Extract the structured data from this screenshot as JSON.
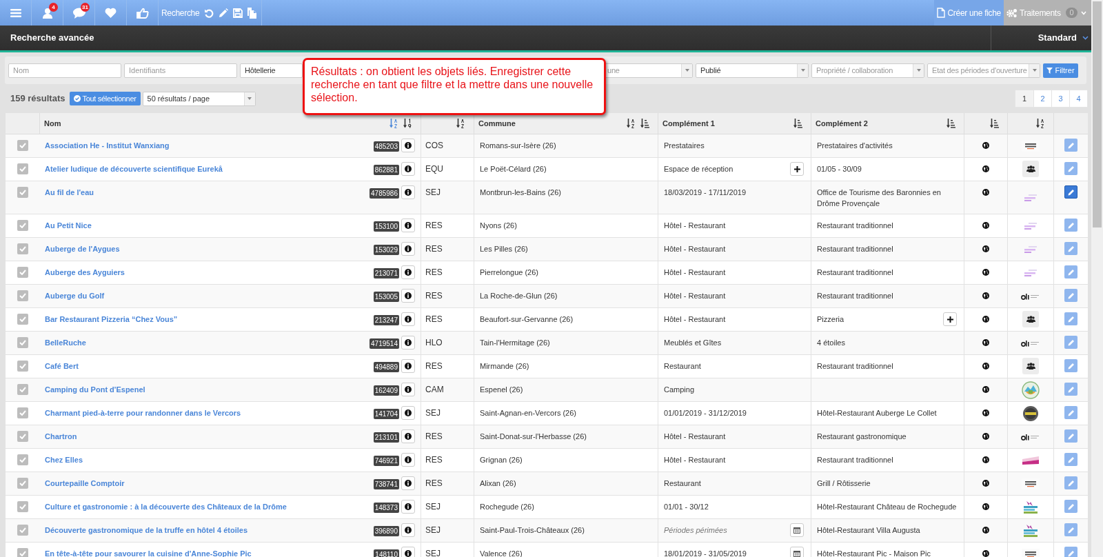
{
  "toolbar": {
    "items": [
      {
        "kind": "menu"
      },
      {
        "kind": "user",
        "badge": "4"
      },
      {
        "kind": "chat",
        "badge": "31"
      },
      {
        "kind": "heart"
      },
      {
        "kind": "thumb"
      }
    ],
    "search_label": "Recherche",
    "search_actions": [
      {
        "kind": "undo"
      },
      {
        "kind": "pencil"
      },
      {
        "kind": "save"
      },
      {
        "kind": "copy"
      }
    ],
    "create_button": "Créer une fiche",
    "treatments": {
      "label": "Traitements",
      "count": "0"
    }
  },
  "header": {
    "title": "Recherche avancée",
    "view": "Standard"
  },
  "filters": [
    {
      "kind": "text",
      "placeholder": "Nom"
    },
    {
      "kind": "text",
      "placeholder": "Identifiants"
    },
    {
      "kind": "select",
      "value": "Hôtellerie"
    },
    {
      "kind": "select",
      "placeholder": "une"
    },
    {
      "kind": "select",
      "value": "Publié"
    },
    {
      "kind": "select",
      "placeholder": "Propriété / collaboration"
    },
    {
      "kind": "select",
      "placeholder": "Etat des périodes d'ouverture"
    }
  ],
  "filter_button": "Filtrer",
  "callout": "Résultats : on obtient les objets liés. Enregistrer cette recherche en tant que filtre et la mettre dans une nouvelle sélection.",
  "results": {
    "count": "159 résultats",
    "select_all": "Tout sélectionner",
    "page_size": "50 résultats / page",
    "pages": [
      {
        "label": "1",
        "selected": true
      },
      {
        "label": "2",
        "selected": false
      },
      {
        "label": "3",
        "selected": false
      },
      {
        "label": "4",
        "selected": false
      }
    ]
  },
  "table": {
    "columns": [
      {},
      {
        "label": "Nom",
        "sort_icons": [
          {
            "kind": "az",
            "selected": true
          },
          {
            "kind": "numeric",
            "selected": false
          }
        ]
      },
      {
        "sort_icons": [
          {
            "kind": "az",
            "selected": false
          }
        ]
      },
      {
        "label": "Commune",
        "sort_icons": [
          {
            "kind": "az",
            "selected": false
          },
          {
            "kind": "bars",
            "selected": false
          }
        ]
      },
      {
        "label": "Complément 1",
        "sort_icons": [
          {
            "kind": "bars",
            "selected": false
          }
        ]
      },
      {
        "label": "Complément 2",
        "sort_icons": [
          {
            "kind": "bars",
            "selected": false
          }
        ]
      },
      {
        "sort_icons": [
          {
            "kind": "bars",
            "selected": false
          }
        ]
      },
      {
        "sort_icons": [
          {
            "kind": "az",
            "selected": false
          }
        ]
      },
      {}
    ],
    "rows": [
      {
        "checked": true,
        "name": "Association He - Institut Wanxiang",
        "id": "485203",
        "type": "COS",
        "commune": "Romans-sur-Isère (26)",
        "complement_1": {
          "text": "Prestataires",
          "italic": false
        },
        "complement_2": {
          "text": "Prestataires d'activités"
        },
        "logo": {
          "kind": "valence"
        },
        "edit_active": false
      },
      {
        "checked": true,
        "name": "Atelier ludique de découverte scientifique Eurekå",
        "id": "862881",
        "type": "EQU",
        "commune": "Le Poët-Célard (26)",
        "complement_1": {
          "text": "Espace de réception",
          "italic": false,
          "button": {
            "kind": "plus"
          }
        },
        "complement_2": {
          "text": "01/05 - 30/09"
        },
        "logo": {
          "kind": "people"
        },
        "edit_active": false
      },
      {
        "checked": true,
        "name": "Au fil de l'eau",
        "id": "4785986",
        "type": "SEJ",
        "commune": "Montbrun-les-Bains (26)",
        "complement_1": {
          "text": "18/03/2019 - 17/11/2019",
          "italic": false
        },
        "complement_2": {
          "text": "Office de Tourisme des Baronnies en Drôme Provençale"
        },
        "logo": {
          "kind": "purple"
        },
        "edit_active": true
      },
      {
        "checked": true,
        "name": "Au Petit Nice",
        "id": "153100",
        "type": "RES",
        "commune": "Nyons (26)",
        "complement_1": {
          "text": "Hôtel - Restaurant",
          "italic": false
        },
        "complement_2": {
          "text": "Restaurant traditionnel"
        },
        "logo": {
          "kind": "purple"
        },
        "edit_active": false
      },
      {
        "checked": true,
        "name": "Auberge de l'Aygues",
        "id": "153029",
        "type": "RES",
        "commune": "Les Pilles (26)",
        "complement_1": {
          "text": "Hôtel - Restaurant",
          "italic": false
        },
        "complement_2": {
          "text": "Restaurant traditionnel"
        },
        "logo": {
          "kind": "purple"
        },
        "edit_active": false
      },
      {
        "checked": true,
        "name": "Auberge des Ayguiers",
        "id": "213071",
        "type": "RES",
        "commune": "Pierrelongue (26)",
        "complement_1": {
          "text": "Hôtel - Restaurant",
          "italic": false
        },
        "complement_2": {
          "text": "Restaurant traditionnel"
        },
        "logo": {
          "kind": "purple"
        },
        "edit_active": false
      },
      {
        "checked": true,
        "name": "Auberge du Golf",
        "id": "153005",
        "type": "RES",
        "commune": "La Roche-de-Glun (26)",
        "complement_1": {
          "text": "Hôtel - Restaurant",
          "italic": false
        },
        "complement_2": {
          "text": "Restaurant traditionnel"
        },
        "logo": {
          "kind": "ah"
        },
        "edit_active": false
      },
      {
        "checked": true,
        "name": "Bar Restaurant Pizzeria “Chez Vous”",
        "id": "213247",
        "type": "RES",
        "commune": "Beaufort-sur-Gervanne (26)",
        "complement_1": {
          "text": "Hôtel - Restaurant",
          "italic": false
        },
        "complement_2": {
          "text": "Pizzeria",
          "button": {
            "kind": "plus"
          }
        },
        "logo": {
          "kind": "people"
        },
        "edit_active": false
      },
      {
        "checked": true,
        "name": "BelleRuche",
        "id": "4719514",
        "type": "HLO",
        "commune": "Tain-l'Hermitage (26)",
        "complement_1": {
          "text": "Meublés et Gîtes",
          "italic": false
        },
        "complement_2": {
          "text": "4 étoiles"
        },
        "logo": {
          "kind": "ah"
        },
        "edit_active": false
      },
      {
        "checked": true,
        "name": "Café Bert",
        "id": "494889",
        "type": "RES",
        "commune": "Mirmande (26)",
        "complement_1": {
          "text": "Restaurant",
          "italic": false
        },
        "complement_2": {
          "text": "Restaurant traditionnel"
        },
        "logo": {
          "kind": "people"
        },
        "edit_active": false
      },
      {
        "checked": true,
        "name": "Camping du Pont d'Espenel",
        "id": "162409",
        "type": "CAM",
        "commune": "Espenel (26)",
        "complement_1": {
          "text": "Camping",
          "italic": false
        },
        "complement_2": {},
        "logo": {
          "kind": "camping"
        },
        "edit_active": false
      },
      {
        "checked": true,
        "name": "Charmant pied-à-terre pour randonner dans le Vercors",
        "id": "141704",
        "type": "SEJ",
        "commune": "Saint-Agnan-en-Vercors (26)",
        "complement_1": {
          "text": "01/01/2019 - 31/12/2019",
          "italic": false
        },
        "complement_2": {
          "text": "Hôtel-Restaurant Auberge Le Collet"
        },
        "logo": {
          "kind": "dark"
        },
        "edit_active": false
      },
      {
        "checked": true,
        "name": "Chartron",
        "id": "213101",
        "type": "RES",
        "commune": "Saint-Donat-sur-l'Herbasse (26)",
        "complement_1": {
          "text": "Hôtel - Restaurant",
          "italic": false
        },
        "complement_2": {
          "text": "Restaurant gastronomique"
        },
        "logo": {
          "kind": "ah"
        },
        "edit_active": false
      },
      {
        "checked": true,
        "name": "Chez Elles",
        "id": "746921",
        "type": "RES",
        "commune": "Grignan (26)",
        "complement_1": {
          "text": "Hôtel - Restaurant",
          "italic": false
        },
        "complement_2": {
          "text": "Restaurant traditionnel"
        },
        "logo": {
          "kind": "pink"
        },
        "edit_active": false
      },
      {
        "checked": true,
        "name": "Courtepaille Comptoir",
        "id": "738741",
        "type": "RES",
        "commune": "Alixan (26)",
        "complement_1": {
          "text": "Restaurant",
          "italic": false
        },
        "complement_2": {
          "text": "Grill / Rôtisserie"
        },
        "logo": {
          "kind": "valence"
        },
        "edit_active": false
      },
      {
        "checked": true,
        "name": "Culture et gastronomie : à la découverte des Châteaux de la Drôme",
        "id": "148373",
        "type": "SEJ",
        "commune": "Rochegude (26)",
        "complement_1": {
          "text": "01/01 - 30/12",
          "italic": false
        },
        "complement_2": {
          "text": "Hôtel-Restaurant Château de Rochegude"
        },
        "logo": {
          "kind": "drome"
        },
        "edit_active": false
      },
      {
        "checked": true,
        "name": "Découverte gastronomique de la truffe en hôtel 4 étoiles",
        "id": "396890",
        "type": "SEJ",
        "commune": "Saint-Paul-Trois-Châteaux (26)",
        "complement_1": {
          "text": "Périodes périmées",
          "italic": true,
          "button": {
            "kind": "calendar"
          }
        },
        "complement_2": {
          "text": "Hôtel-Restaurant Villa Augusta"
        },
        "logo": {
          "kind": "drome"
        },
        "edit_active": false
      },
      {
        "checked": true,
        "name": "En tête-à-tête pour savourer la cuisine d'Anne-Sophie Pic",
        "id": "148110",
        "type": "SEJ",
        "commune": "Valence (26)",
        "complement_1": {
          "text": "18/01/2019 - 31/05/2019",
          "italic": false,
          "button": {
            "kind": "calendar"
          }
        },
        "complement_2": {
          "text": "Hôtel-Restaurant Pic - Maison Pic"
        },
        "logo": {
          "kind": "valence"
        },
        "edit_active": false
      }
    ]
  }
}
